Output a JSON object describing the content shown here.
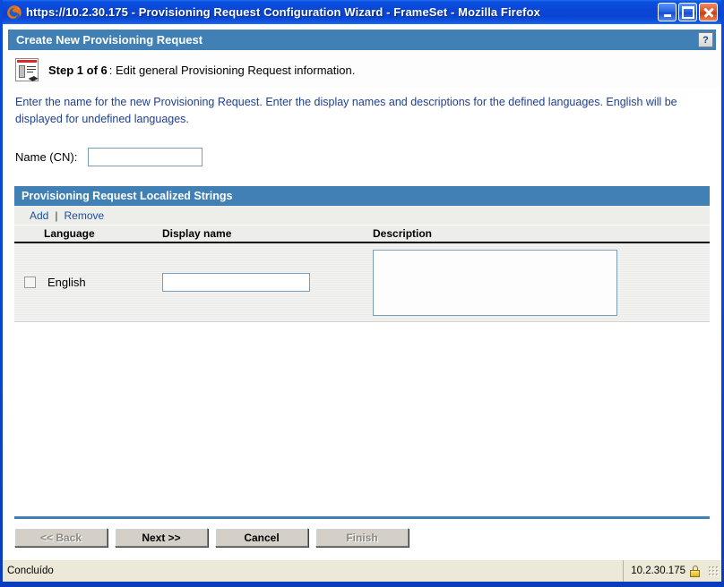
{
  "window": {
    "title": "https://10.2.30.175 - Provisioning Request Configuration Wizard - FrameSet - Mozilla Firefox",
    "app_icon": "firefox-icon",
    "controls": {
      "minimize": "minimize-icon",
      "maximize": "maximize-icon",
      "close": "close-icon"
    }
  },
  "dialog": {
    "header_title": "Create New Provisioning Request",
    "help_label": "?",
    "step_icon": "form-document-icon",
    "step_label": "Step 1 of 6",
    "step_description": ":  Edit general Provisioning Request information.",
    "intro_text": "Enter the name for the new Provisioning Request.  Enter the display names and descriptions for the defined languages.  English will be displayed for undefined languages."
  },
  "name_field": {
    "label": "Name (CN):",
    "value": "",
    "placeholder": ""
  },
  "localized_strings": {
    "panel_title": "Provisioning Request Localized Strings",
    "actions": {
      "add_label": "Add",
      "separator": "|",
      "remove_label": "Remove"
    },
    "columns": [
      "Language",
      "Display name",
      "Description"
    ],
    "rows": [
      {
        "selected": false,
        "language": "English",
        "display_name": "",
        "description": ""
      }
    ]
  },
  "footer": {
    "buttons": [
      {
        "label": "<< Back",
        "name": "back-button",
        "disabled": true
      },
      {
        "label": "Next >>",
        "name": "next-button",
        "disabled": false
      },
      {
        "label": "Cancel",
        "name": "cancel-button",
        "disabled": false
      },
      {
        "label": "Finish",
        "name": "finish-button",
        "disabled": true
      }
    ]
  },
  "statusbar": {
    "status_text": "Concluído",
    "host": "10.2.30.175",
    "security_icon": "padlock-icon",
    "resize_grip": "resize-grip-icon"
  },
  "colors": {
    "titlebar_blue": "#0a46d4",
    "dialog_header_blue": "#4180b4",
    "intro_text_blue": "#1f3f8f",
    "link_blue": "#1a4f9c",
    "row_gray": "#e9e9e6",
    "status_bg": "#ece9d8",
    "input_border": "#7a9cbd"
  }
}
